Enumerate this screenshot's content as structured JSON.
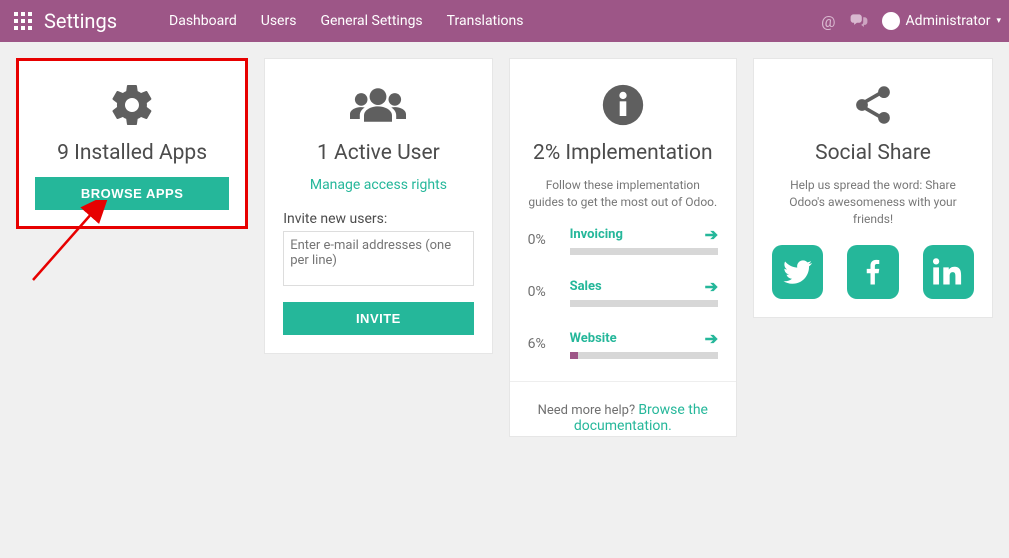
{
  "header": {
    "title": "Settings",
    "nav": [
      "Dashboard",
      "Users",
      "General Settings",
      "Translations"
    ],
    "user": "Administrator"
  },
  "apps_card": {
    "title": "9 Installed Apps",
    "button": "Browse Apps"
  },
  "users_card": {
    "title": "1 Active User",
    "manage": "Manage access rights",
    "invite_label": "Invite new users:",
    "placeholder": "Enter e-mail addresses (one per line)",
    "button": "Invite"
  },
  "impl_card": {
    "title": "2% Implementation",
    "sub": "Follow these implementation guides to get the most out of Odoo.",
    "items": [
      {
        "pct": "0%",
        "label": "Invoicing",
        "width": "0%"
      },
      {
        "pct": "0%",
        "label": "Sales",
        "width": "0%"
      },
      {
        "pct": "6%",
        "label": "Website",
        "width": "6%"
      }
    ],
    "help_prefix": "Need more help? ",
    "help_link": "Browse the documentation."
  },
  "share_card": {
    "title": "Social Share",
    "sub": "Help us spread the word: Share Odoo's awesomeness with your friends!"
  }
}
